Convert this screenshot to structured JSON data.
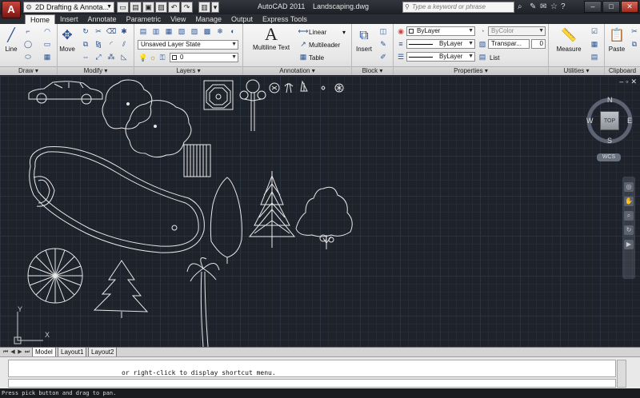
{
  "titlebar": {
    "app_name": "AutoCAD 2011",
    "file_name": "Landscaping.dwg",
    "workspace": "2D Drafting & Annota...",
    "search_placeholder": "Type a keyword or phrase",
    "logo_letter": "A"
  },
  "tabs": [
    {
      "label": "Home",
      "active": true
    },
    {
      "label": "Insert"
    },
    {
      "label": "Annotate"
    },
    {
      "label": "Parametric"
    },
    {
      "label": "View"
    },
    {
      "label": "Manage"
    },
    {
      "label": "Output"
    },
    {
      "label": "Express Tools"
    }
  ],
  "ribbon": {
    "draw": {
      "title": "Draw",
      "line": "Line"
    },
    "modify": {
      "title": "Modify",
      "move": "Move"
    },
    "layers": {
      "title": "Layers",
      "layer_state": "Unsaved Layer State",
      "current_layer": "0"
    },
    "annotation": {
      "title": "Annotation",
      "mtext": "Multiline Text",
      "linear": "Linear",
      "multileader": "Multileader",
      "table": "Table"
    },
    "block": {
      "title": "Block",
      "insert": "Insert"
    },
    "properties": {
      "title": "Properties",
      "color": "ByLayer",
      "linetype": "ByLayer",
      "lineweight": "ByLayer",
      "plotstyle": "ByColor",
      "transparency": "Transpar...",
      "transparency_value": "0",
      "list": "List"
    },
    "utilities": {
      "title": "Utilities",
      "measure": "Measure"
    },
    "clipboard": {
      "title": "Clipboard",
      "paste": "Paste"
    }
  },
  "viewcube": {
    "n": "N",
    "s": "S",
    "e": "E",
    "w": "W",
    "face": "TOP",
    "wcs": "WCS"
  },
  "ucs": {
    "x": "X",
    "y": "Y"
  },
  "layout_tabs": [
    {
      "label": "Model",
      "active": true
    },
    {
      "label": "Layout1"
    },
    {
      "label": "Layout2"
    }
  ],
  "command": {
    "history": "or right-click to display shortcut menu.",
    "status": "Press pick button and drag to pan."
  },
  "colors": {
    "background": "#1e222b",
    "linework": "#e8e8e8",
    "ribbon": "#ececec"
  }
}
